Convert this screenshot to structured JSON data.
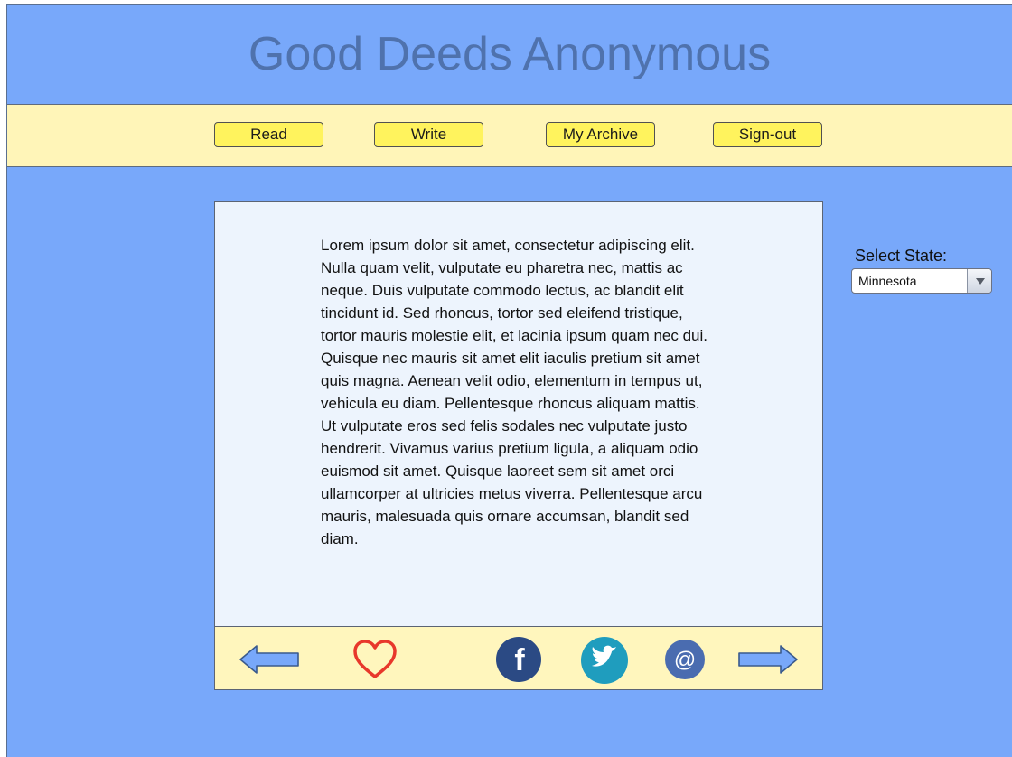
{
  "header": {
    "title": "Good Deeds Anonymous"
  },
  "nav": {
    "read": "Read",
    "write": "Write",
    "archive": "My Archive",
    "signout": "Sign-out"
  },
  "story": {
    "text": "Lorem ipsum dolor sit amet, consectetur adipiscing elit. Nulla quam velit, vulputate eu pharetra nec, mattis ac neque. Duis vulputate commodo lectus, ac blandit elit tincidunt id. Sed rhoncus, tortor sed eleifend tristique, tortor mauris molestie elit, et lacinia ipsum quam nec dui. Quisque nec mauris sit amet elit iaculis pretium sit amet quis magna. Aenean velit odio, elementum in tempus ut, vehicula eu diam. Pellentesque rhoncus aliquam mattis. Ut vulputate eros sed felis sodales nec vulputate justo hendrerit. Vivamus varius pretium ligula, a aliquam odio euismod sit amet. Quisque laoreet sem sit amet orci ullamcorper at ultricies metus viverra. Pellentesque arcu mauris, malesuada quis ornare accumsan, blandit sed diam."
  },
  "actions": {
    "icons": [
      "arrow-left-icon",
      "heart-icon",
      "facebook-icon",
      "twitter-icon",
      "at-icon",
      "arrow-right-icon"
    ],
    "facebook_glyph": "f",
    "at_glyph": "@"
  },
  "state": {
    "label": "Select State:",
    "selected": "Minnesota"
  },
  "colors": {
    "background": "#78a8fa",
    "title": "#4f72ad",
    "nav_bar": "#fff5b8",
    "button": "#fff35d",
    "heart": "#e8382b",
    "facebook": "#2b4a84",
    "twitter": "#1f9dbe",
    "email": "#4a6cb0"
  }
}
